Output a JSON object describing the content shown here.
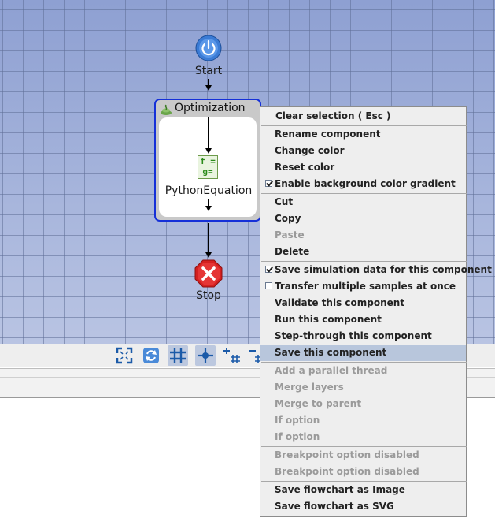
{
  "flowchart": {
    "start_label": "Start",
    "optimization_label": "Optimization",
    "equation_label": "PythonEquation",
    "equation_icon_lines": [
      "f =",
      "g="
    ],
    "stop_label": "Stop"
  },
  "toolbar": {
    "icons": [
      "fit-to-screen-icon",
      "refresh-icon",
      "grid-icon",
      "snap-icon",
      "grid-plus-icon",
      "grid-minus-icon"
    ]
  },
  "context_menu": {
    "items": [
      {
        "label": "Clear selection ( Esc )",
        "enabled": true
      },
      {
        "label": "Rename component",
        "enabled": true
      },
      {
        "label": "Change color",
        "enabled": true
      },
      {
        "label": "Reset color",
        "enabled": true
      },
      {
        "label": "Enable background color gradient",
        "enabled": true,
        "checked": true
      },
      {
        "label": "Cut",
        "enabled": true
      },
      {
        "label": "Copy",
        "enabled": true
      },
      {
        "label": "Paste",
        "enabled": false
      },
      {
        "label": "Delete",
        "enabled": true
      },
      {
        "label": "Save simulation data for this component",
        "enabled": true,
        "checked": true
      },
      {
        "label": "Transfer multiple samples at once",
        "enabled": true,
        "checked": false
      },
      {
        "label": "Validate this component",
        "enabled": true
      },
      {
        "label": "Run this component",
        "enabled": true
      },
      {
        "label": "Step-through this component",
        "enabled": true
      },
      {
        "label": "Save this component",
        "enabled": true,
        "highlighted": true
      },
      {
        "label": "Add a parallel thread",
        "enabled": false
      },
      {
        "label": "Merge layers",
        "enabled": false
      },
      {
        "label": "Merge to parent",
        "enabled": false
      },
      {
        "label": "If option",
        "enabled": false
      },
      {
        "label": "If option",
        "enabled": false
      },
      {
        "label": "Breakpoint option disabled",
        "enabled": false
      },
      {
        "label": "Breakpoint option disabled",
        "enabled": false
      },
      {
        "label": "Save flowchart as Image",
        "enabled": true
      },
      {
        "label": "Save flowchart as SVG",
        "enabled": true
      }
    ]
  },
  "colors": {
    "canvas_bg": "#a9b7dc",
    "selection_border": "#1530d8",
    "start_blue": "#3a7bd5",
    "stop_red": "#d42020",
    "menu_highlight": "#b8c6dc"
  }
}
